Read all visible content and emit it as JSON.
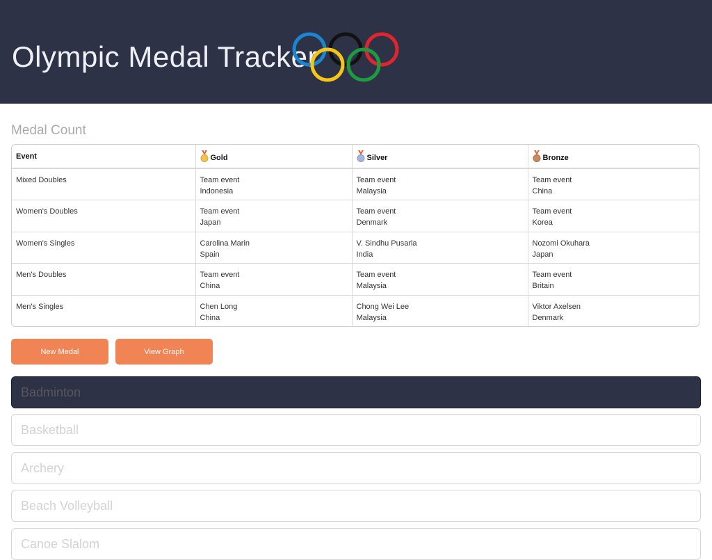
{
  "header": {
    "title": "Olympic Medal Tracker",
    "logo": "olympic-rings"
  },
  "medal_count": {
    "title": "Medal Count",
    "columns": [
      "Event",
      "Gold",
      "Silver",
      "Bronze"
    ],
    "rows": [
      {
        "event": "Mixed Doubles",
        "gold": {
          "athlete": "Team event",
          "country": "Indonesia"
        },
        "silver": {
          "athlete": "Team event",
          "country": "Malaysia"
        },
        "bronze": {
          "athlete": "Team event",
          "country": "China"
        }
      },
      {
        "event": "Women's Doubles",
        "gold": {
          "athlete": "Team event",
          "country": "Japan"
        },
        "silver": {
          "athlete": "Team event",
          "country": "Denmark"
        },
        "bronze": {
          "athlete": "Team event",
          "country": "Korea"
        }
      },
      {
        "event": "Women's Singles",
        "gold": {
          "athlete": "Carolina Marin",
          "country": "Spain"
        },
        "silver": {
          "athlete": "V. Sindhu Pusarla",
          "country": "India"
        },
        "bronze": {
          "athlete": "Nozomi Okuhara",
          "country": "Japan"
        }
      },
      {
        "event": "Men's Doubles",
        "gold": {
          "athlete": "Team event",
          "country": "China"
        },
        "silver": {
          "athlete": "Team event",
          "country": "Malaysia"
        },
        "bronze": {
          "athlete": "Team event",
          "country": "Britain"
        }
      },
      {
        "event": "Men's Singles",
        "gold": {
          "athlete": "Chen Long",
          "country": "China"
        },
        "silver": {
          "athlete": "Chong Wei Lee",
          "country": "Malaysia"
        },
        "bronze": {
          "athlete": "Viktor Axelsen",
          "country": "Denmark"
        }
      }
    ]
  },
  "buttons": {
    "new_medal": "New Medal",
    "view_graph": "View Graph"
  },
  "sports": [
    {
      "label": "Badminton",
      "active": true
    },
    {
      "label": "Basketball",
      "active": false
    },
    {
      "label": "Archery",
      "active": false
    },
    {
      "label": "Beach Volleyball",
      "active": false
    },
    {
      "label": "Canoe Slalom",
      "active": false
    }
  ],
  "colors": {
    "header_bg": "#2d3246",
    "button_bg": "#f08455",
    "gold": "#f2c14e",
    "silver": "#a9b4e6",
    "bronze": "#c98a5e",
    "ribbon": "#e8613a"
  }
}
